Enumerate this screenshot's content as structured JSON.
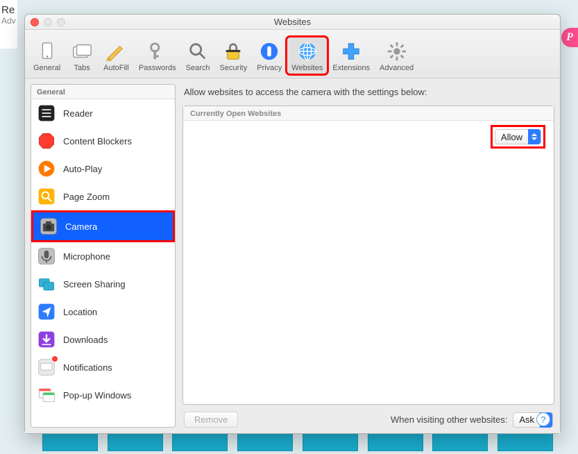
{
  "background": {
    "left_text_line1": "Re",
    "left_text_line2": "Adv",
    "badge_letter": "P"
  },
  "window": {
    "title": "Websites"
  },
  "toolbar": [
    {
      "id": "general",
      "label": "General",
      "icon": "general-icon"
    },
    {
      "id": "tabs",
      "label": "Tabs",
      "icon": "tabs-icon"
    },
    {
      "id": "autofill",
      "label": "AutoFill",
      "icon": "autofill-icon"
    },
    {
      "id": "passwords",
      "label": "Passwords",
      "icon": "passwords-icon"
    },
    {
      "id": "search",
      "label": "Search",
      "icon": "search-icon"
    },
    {
      "id": "security",
      "label": "Security",
      "icon": "security-icon"
    },
    {
      "id": "privacy",
      "label": "Privacy",
      "icon": "privacy-icon"
    },
    {
      "id": "websites",
      "label": "Websites",
      "icon": "websites-icon",
      "selected": true
    },
    {
      "id": "extensions",
      "label": "Extensions",
      "icon": "extensions-icon"
    },
    {
      "id": "advanced",
      "label": "Advanced",
      "icon": "advanced-icon"
    }
  ],
  "sidebar": {
    "header": "General",
    "items": [
      {
        "id": "reader",
        "label": "Reader",
        "icon": "reader-icon"
      },
      {
        "id": "content-blockers",
        "label": "Content Blockers",
        "icon": "blockers-icon"
      },
      {
        "id": "autoplay",
        "label": "Auto-Play",
        "icon": "autoplay-icon"
      },
      {
        "id": "page-zoom",
        "label": "Page Zoom",
        "icon": "pagezoom-icon"
      },
      {
        "id": "camera",
        "label": "Camera",
        "icon": "camera-icon",
        "selected": true
      },
      {
        "id": "microphone",
        "label": "Microphone",
        "icon": "microphone-icon"
      },
      {
        "id": "screen-sharing",
        "label": "Screen Sharing",
        "icon": "screenshare-icon"
      },
      {
        "id": "location",
        "label": "Location",
        "icon": "location-icon"
      },
      {
        "id": "downloads",
        "label": "Downloads",
        "icon": "downloads-icon"
      },
      {
        "id": "notifications",
        "label": "Notifications",
        "icon": "notifications-icon",
        "badge": true
      },
      {
        "id": "popup",
        "label": "Pop-up Windows",
        "icon": "popup-icon"
      }
    ]
  },
  "main": {
    "heading": "Allow websites to access the camera with the settings below:",
    "list_header": "Currently Open Websites",
    "rows": [
      {
        "site": "",
        "value": "Allow"
      }
    ],
    "remove_label": "Remove",
    "footer_label": "When visiting other websites:",
    "footer_value": "Ask"
  },
  "help": "?"
}
